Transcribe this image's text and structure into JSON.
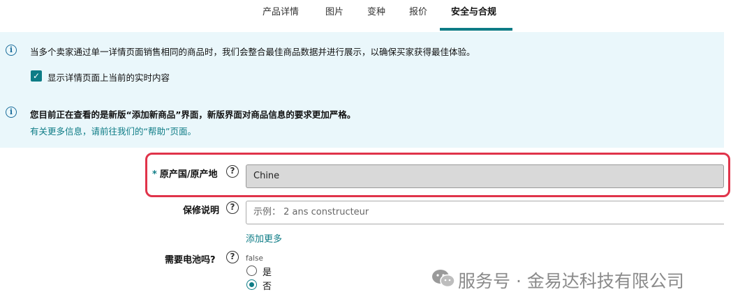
{
  "tabs": [
    {
      "label": "产品详情"
    },
    {
      "label": "图片"
    },
    {
      "label": "变种"
    },
    {
      "label": "报价"
    },
    {
      "label": "安全与合规"
    }
  ],
  "info": {
    "line1": "当多个卖家通过单一详情页面销售相同的商品时，我们会整合最佳商品数据并进行展示，以确保买家获得最佳体验。",
    "checkbox_label": "显示详情页面上当前的实时内容",
    "checkbox_checked": true,
    "line2": "您目前正在查看的是新版“添加新商品”界面，新版界面对商品信息的要求更加严格。",
    "help_link": "有关更多信息，请前往我们的“帮助”页面。"
  },
  "form": {
    "origin": {
      "required_mark": "*",
      "label": "原产国/原产地",
      "value": "Chine"
    },
    "warranty": {
      "label": "保修说明",
      "placeholder": "示例： 2 ans constructeur",
      "add_more": "添加更多"
    },
    "battery": {
      "label": "需要电池吗?",
      "value": "false",
      "options": [
        {
          "label": "是",
          "selected": false
        },
        {
          "label": "否",
          "selected": true
        }
      ]
    }
  },
  "watermark": {
    "text": "服务号 · 金易达科技有限公司"
  },
  "colors": {
    "accent": "#0e7c86",
    "highlight": "#e0334a",
    "info_bg": "#eaf7fb"
  }
}
